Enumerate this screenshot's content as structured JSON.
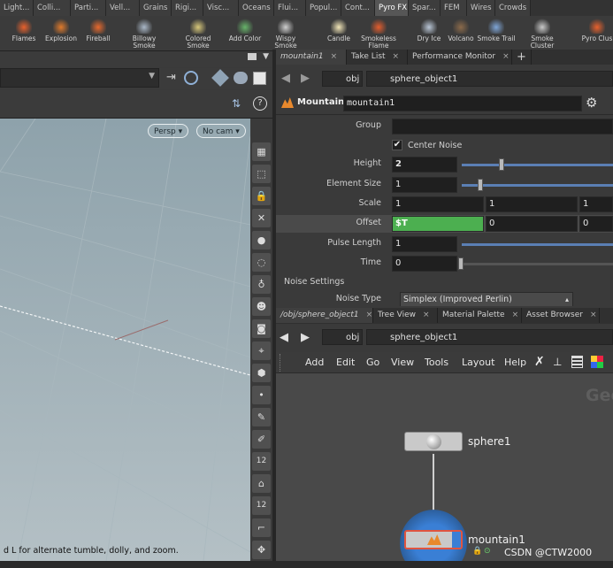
{
  "shelf": {
    "tabs": [
      {
        "label": "Light...",
        "active": false
      },
      {
        "label": "Colli...",
        "active": false
      },
      {
        "label": "Parti...",
        "active": false
      },
      {
        "label": "Vell...",
        "active": false
      },
      {
        "label": "Grains",
        "active": false
      },
      {
        "label": "Rigi...",
        "active": false
      },
      {
        "label": "Popul...",
        "active": false
      },
      {
        "label": "Visc...",
        "active": false
      },
      {
        "label": "Oceans",
        "active": false
      },
      {
        "label": "Flui...",
        "active": false
      },
      {
        "label": "Popul...",
        "active": false
      },
      {
        "label": "Cont...",
        "active": false
      },
      {
        "label": "Pyro FX",
        "active": true
      },
      {
        "label": "Spar...",
        "active": false
      },
      {
        "label": "FEM",
        "active": false
      },
      {
        "label": "Wires",
        "active": false
      },
      {
        "label": "Crowds",
        "active": false
      }
    ],
    "tools": [
      {
        "label": "Flames",
        "icon": "flames-icon"
      },
      {
        "label": "Explosion",
        "icon": "explosion-icon"
      },
      {
        "label": "Fireball",
        "icon": "fireball-icon"
      },
      {
        "label": "Billowy Smoke",
        "icon": "billowy-smoke-icon"
      },
      {
        "label": "Colored Smoke",
        "icon": "colored-smoke-icon"
      },
      {
        "label": "Add Color",
        "icon": "add-color-icon"
      },
      {
        "label": "Wispy Smoke",
        "icon": "wispy-smoke-icon"
      },
      {
        "label": "Candle",
        "icon": "candle-icon"
      },
      {
        "label": "Smokeless Flame",
        "icon": "smokeless-flame-icon"
      },
      {
        "label": "Dry Ice",
        "icon": "dry-ice-icon"
      },
      {
        "label": "Volcano",
        "icon": "volcano-icon"
      },
      {
        "label": "Smoke Trail",
        "icon": "smoke-trail-icon"
      },
      {
        "label": "Smoke Cluster",
        "icon": "smoke-cluster-icon"
      },
      {
        "label": "Pyro Clus",
        "icon": "pyro-cluster-icon"
      }
    ]
  },
  "viewport": {
    "camera_button": "Persp",
    "cam_button": "No cam",
    "status_text": "d L for alternate tumble, dolly, and zoom."
  },
  "side_toolbar": [
    "12",
    "12"
  ],
  "param_pane": {
    "tabs": [
      {
        "label": "mountain1",
        "active": true
      },
      {
        "label": "Take List",
        "active": false
      },
      {
        "label": "Performance Monitor",
        "active": false
      }
    ],
    "path_root": "obj",
    "path_node": "sphere_object1",
    "node_type": "Mountain",
    "node_name": "mountain1",
    "params": {
      "group_label": "Group",
      "group_value": "",
      "center_noise_label": "Center Noise",
      "center_noise_checked": true,
      "height_label": "Height",
      "height_value": "2",
      "element_size_label": "Element Size",
      "element_size_value": "1",
      "scale_label": "Scale",
      "scale_values": [
        "1",
        "1",
        "1"
      ],
      "offset_label": "Offset",
      "offset_values": [
        "$T",
        "0",
        "0"
      ],
      "pulse_length_label": "Pulse Length",
      "pulse_length_value": "1",
      "time_label": "Time",
      "time_value": "0",
      "noise_settings_label": "Noise Settings",
      "noise_type_label": "Noise Type",
      "noise_type_value": "Simplex (Improved Perlin)"
    }
  },
  "network_pane": {
    "tabs": [
      {
        "label": "/obj/sphere_object1",
        "active": true
      },
      {
        "label": "Tree View",
        "active": false
      },
      {
        "label": "Material Palette",
        "active": false
      },
      {
        "label": "Asset Browser",
        "active": false
      }
    ],
    "path_root": "obj",
    "path_node": "sphere_object1",
    "menu": [
      "Add",
      "Edit",
      "Go",
      "View",
      "Tools",
      "Layout",
      "Help"
    ],
    "context_label": "Geo",
    "nodes": [
      {
        "name": "sphere1"
      },
      {
        "name": "mountain1"
      }
    ]
  },
  "watermark": "CSDN @CTW2000",
  "colors": {
    "offset_highlight": "#4caf50",
    "display_flag": "#3a7fd5",
    "node_selected": "#e0543f"
  }
}
